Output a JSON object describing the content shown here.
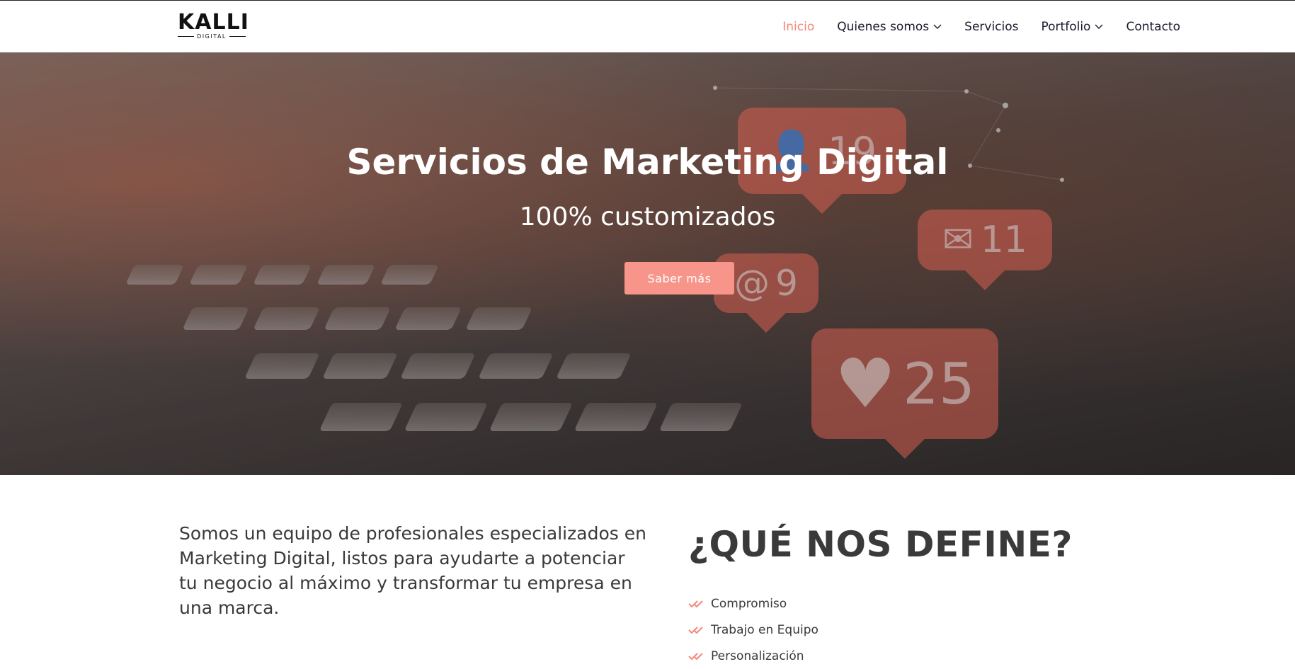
{
  "brand": {
    "logo_main": "KALLI",
    "logo_sub": "DIGITAL"
  },
  "nav": {
    "items": [
      {
        "label": "Inicio",
        "active": true,
        "dropdown": false
      },
      {
        "label": "Quienes somos",
        "active": false,
        "dropdown": true
      },
      {
        "label": "Servicios",
        "active": false,
        "dropdown": false
      },
      {
        "label": "Portfolio",
        "active": false,
        "dropdown": true
      },
      {
        "label": "Contacto",
        "active": false,
        "dropdown": false
      }
    ]
  },
  "hero": {
    "title": "Servicios de Marketing Digital",
    "subtitle": "100% customizados",
    "button_label": "Saber más",
    "bubbles": [
      {
        "icon": "user-icon",
        "count": "19"
      },
      {
        "icon": "mail-icon",
        "count": "11"
      },
      {
        "icon": "at-icon",
        "count": "9"
      },
      {
        "icon": "heart-icon",
        "count": "25"
      }
    ]
  },
  "about": {
    "text": "Somos un equipo de profesionales especializados en Marketing Digital, listos para ayudarte a potenciar tu negocio al máximo y transformar tu empresa en una marca."
  },
  "define": {
    "title": "¿QUÉ NOS DEFINE?",
    "items": [
      "Compromiso",
      "Trabajo en Equipo",
      "Personalización"
    ]
  },
  "colors": {
    "accent": "#f7867a",
    "button": "#f7958a",
    "text": "#3a3a3a"
  }
}
